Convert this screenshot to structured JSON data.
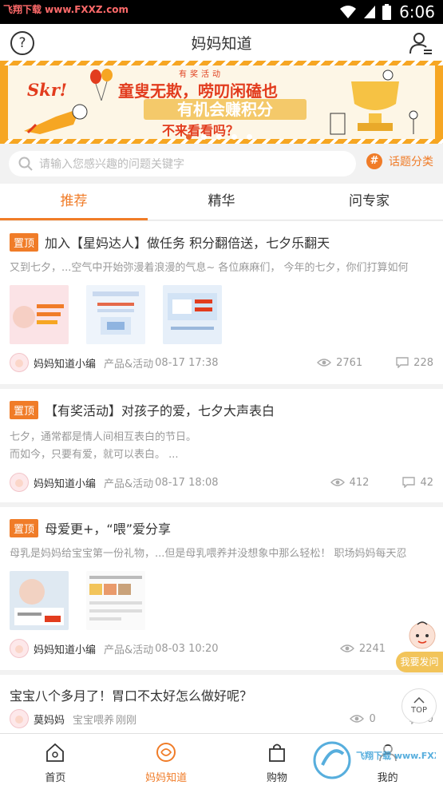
{
  "statusbar": {
    "watermark": "飞翔下载 www.FXXZ.com",
    "time": "6:06"
  },
  "header": {
    "title": "妈妈知道"
  },
  "banner": {
    "tag": "有奖活动",
    "skr": "Skr!",
    "line1": "童叟无欺，唠叨闲磕也",
    "line2": "有机会赚积分",
    "line3": "不来看看吗？",
    "slide_count": 5,
    "active_slide": 0
  },
  "search": {
    "placeholder": "请输入您感兴趣的问题关键字",
    "topic_label": "话题分类"
  },
  "tabs": [
    {
      "label": "推荐",
      "active": true
    },
    {
      "label": "精华",
      "active": false
    },
    {
      "label": "问专家",
      "active": false
    }
  ],
  "posts": [
    {
      "pinned": true,
      "pin_label": "置顶",
      "title": "加入【星妈达人】做任务 积分翻倍送，七夕乐翻天",
      "excerpt": "又到七夕，...空气中开始弥漫着浪漫的气息~  各位麻麻们，  今年的七夕，你们打算如何",
      "thumbs": 3,
      "author": "妈妈知道小编",
      "category": "产品&活动",
      "time": "08-17 17:38",
      "views": "2761",
      "comments": "228"
    },
    {
      "pinned": true,
      "pin_label": "置顶",
      "title": "【有奖活动】对孩子的爱，七夕大声表白",
      "excerpt_lines": [
        "七夕，通常都是情人间相互表白的节日。",
        "而如今，只要有爱，就可以表白。 ..."
      ],
      "author": "妈妈知道小编",
      "category": "产品&活动",
      "time": "08-17 18:08",
      "views": "412",
      "comments": "42"
    },
    {
      "pinned": true,
      "pin_label": "置顶",
      "title": "母爱更+，“喂”爱分享",
      "excerpt": "母乳是妈妈给宝宝第一份礼物，...但是母乳喂养并没想象中那么轻松！  职场妈妈每天忍",
      "thumbs": 2,
      "author": "妈妈知道小编",
      "category": "产品&活动",
      "time": "08-03 10:20",
      "views": "2241",
      "comments": ""
    },
    {
      "pinned": false,
      "title": "宝宝八个多月了！胃口不太好怎么做好呢？",
      "author": "莫妈妈",
      "category": "宝宝喂养",
      "time": "刚刚",
      "views": "0",
      "comments": "0"
    }
  ],
  "float": {
    "ask_label": "我要发问",
    "top_label": "TOP"
  },
  "bottomnav": [
    {
      "label": "首页",
      "icon": "home-icon",
      "active": false
    },
    {
      "label": "妈妈知道",
      "icon": "mama-know-icon",
      "active": true
    },
    {
      "label": "购物",
      "icon": "shopping-bag-icon",
      "active": false
    },
    {
      "label": "我的",
      "icon": "profile-icon",
      "active": false
    }
  ],
  "watermark_br": "飞翔下载 www.FXXZ.com",
  "colors": {
    "accent": "#f07c28",
    "banner": "#f6a623",
    "banner_red": "#e23c1e"
  }
}
